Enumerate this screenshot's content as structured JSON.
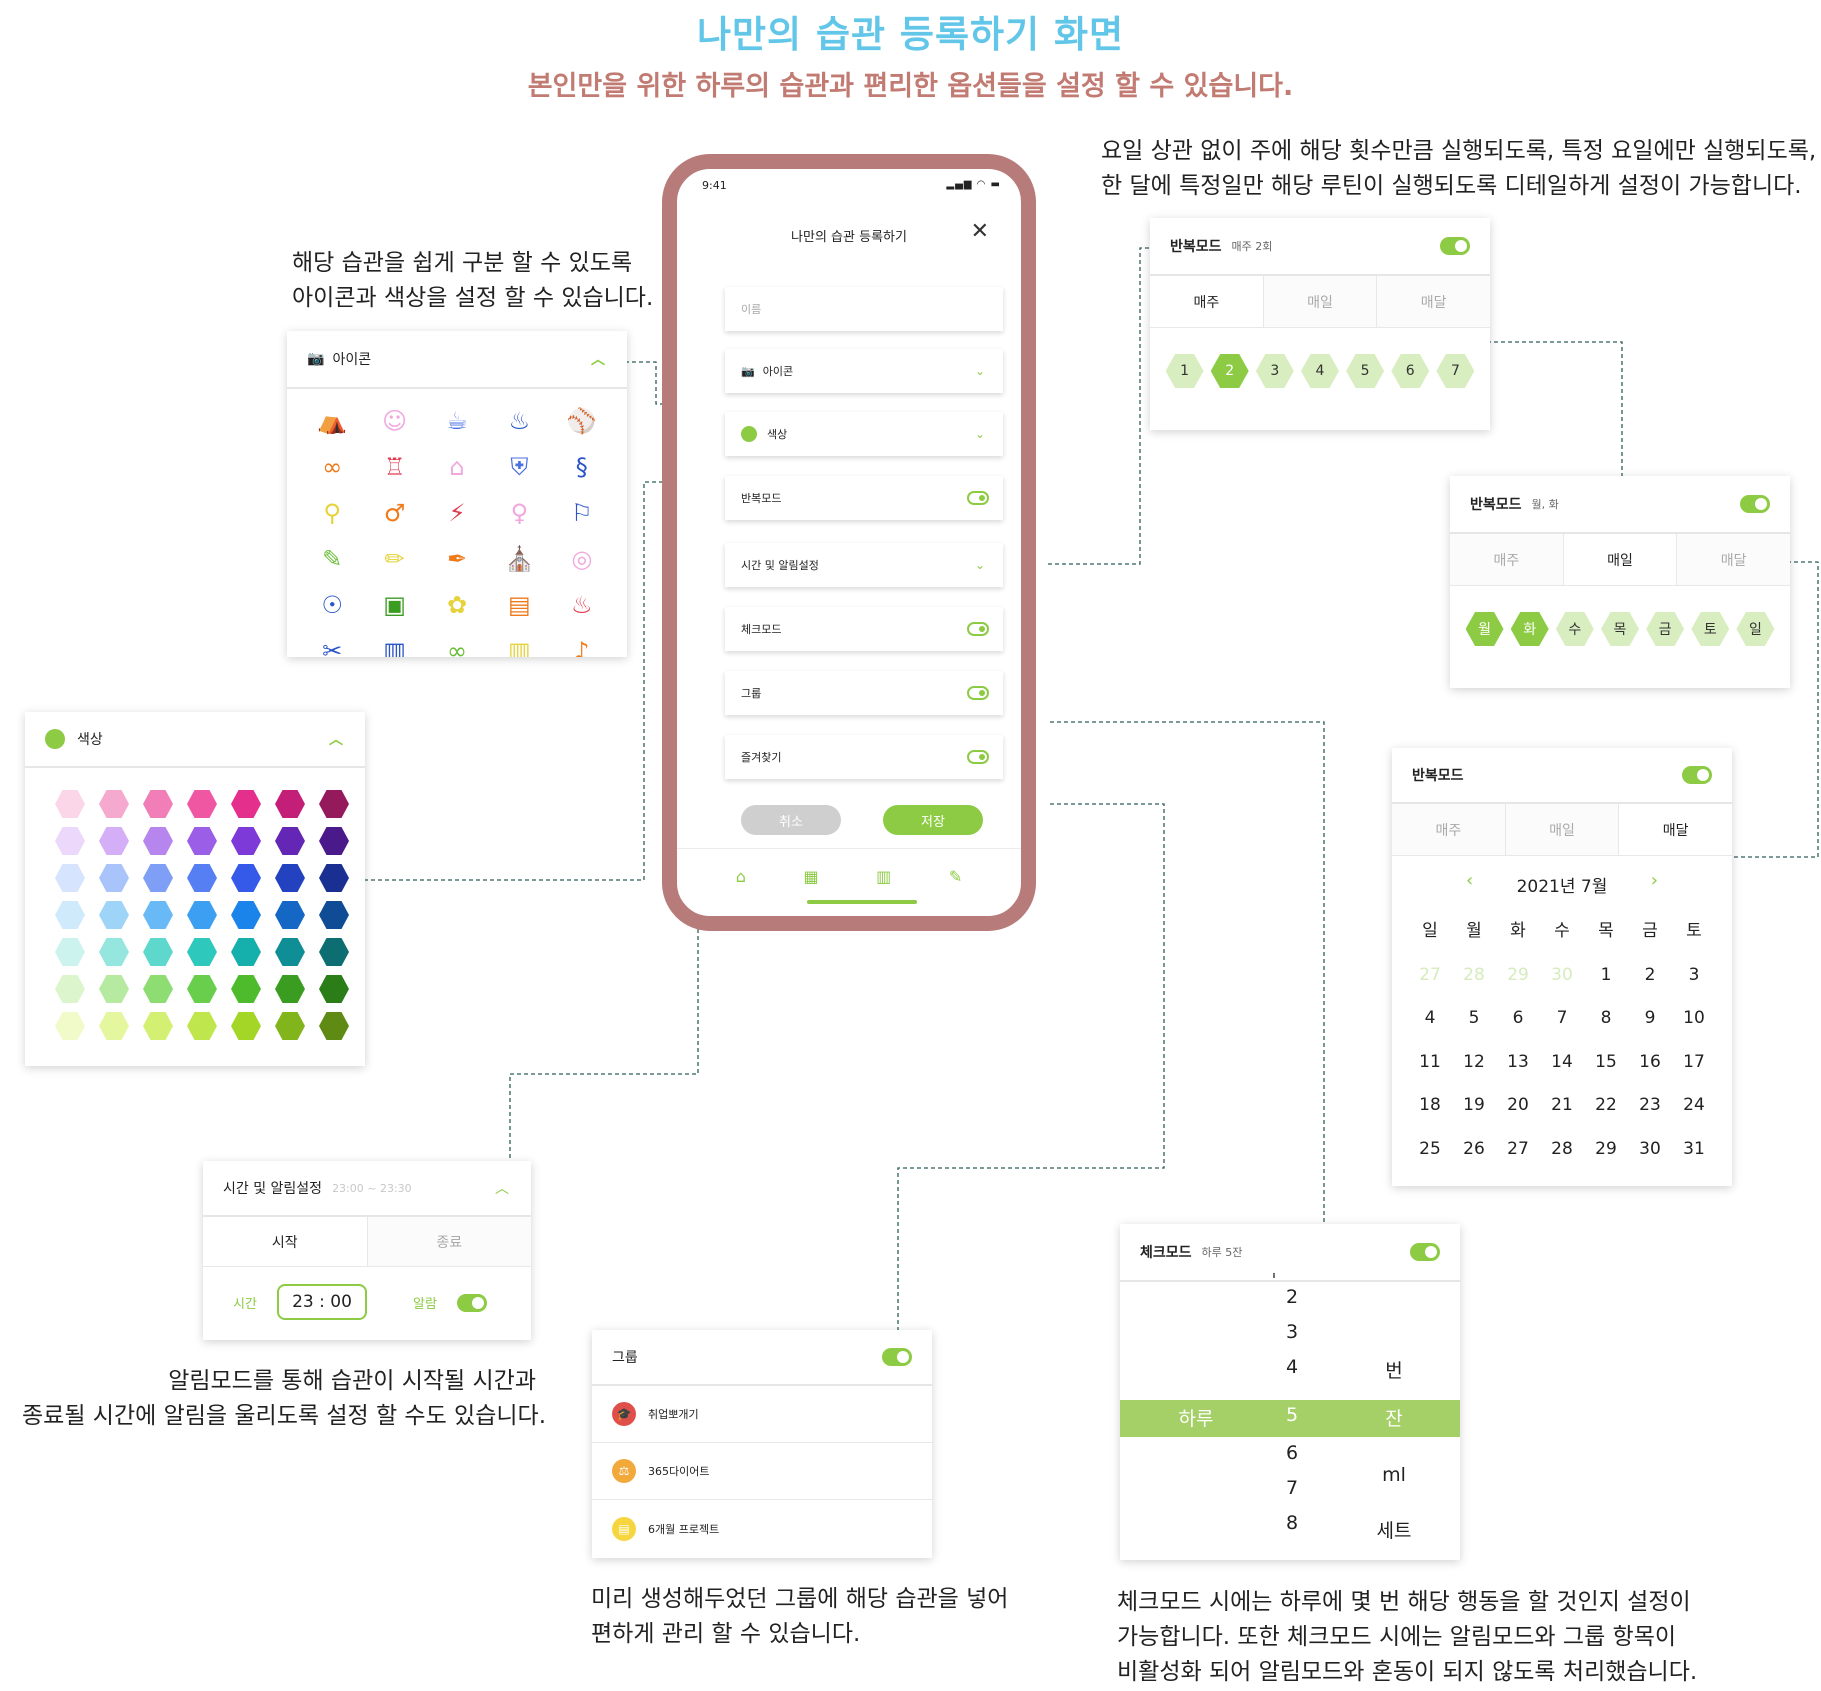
{
  "header": {
    "title": "나만의 습관 등록하기 화면",
    "subtitle": "본인만을 위한 하루의 습관과 편리한 옵션들을 설정 할 수 있습니다."
  },
  "descriptions": {
    "icon_color": [
      "해당 습관을 쉽게 구분 할 수 있도록",
      "아이콘과 색상을 설정 할 수 있습니다."
    ],
    "repeat": [
      "요일 상관 없이 주에 해당 횟수만큼 실행되도록, 특정 요일에만 실행되도록,",
      "한 달에 특정일만 해당 루틴이 실행되도록 디테일하게 설정이 가능합니다."
    ],
    "alarm": [
      "알림모드를 통해 습관이 시작될 시간과",
      "종료될 시간에 알림을 울리도록 설정 할 수도 있습니다."
    ],
    "group": [
      "미리 생성해두었던 그룹에 해당 습관을 넣어",
      "편하게 관리 할 수 있습니다."
    ],
    "check": [
      "체크모드 시에는 하루에 몇 번 해당 행동을 할 것인지 설정이",
      "가능합니다. 또한 체크모드 시에는 알림모드와 그룹 항목이",
      "비활성화 되어 알림모드와 혼동이 되지 않도록 처리했습니다."
    ]
  },
  "phone": {
    "time": "9:41",
    "title": "나만의 습관 등록하기",
    "name_placeholder": "이름",
    "rows": {
      "icon": "아이콘",
      "color": "색상",
      "repeat": "반복모드",
      "time_alarm": "시간 및 알림설정",
      "check": "체크모드",
      "group": "그룹",
      "favorite": "즐겨찾기"
    },
    "cancel": "취소",
    "save": "저장"
  },
  "icon_card": {
    "title": "아이콘"
  },
  "color_card": {
    "title": "색상",
    "rows": [
      [
        "#fbd6e8",
        "#f6a9cf",
        "#f27eb8",
        "#ef57a3",
        "#e52f8d",
        "#c41f78",
        "#951a5b"
      ],
      [
        "#ecd8fb",
        "#d4aef6",
        "#b785ee",
        "#9b5ee6",
        "#7e3ad8",
        "#6326b5",
        "#4a1a8a"
      ],
      [
        "#d6e4fd",
        "#a9c3fb",
        "#7f9ff7",
        "#577ff4",
        "#3559e8",
        "#2242c0",
        "#1a2f92"
      ],
      [
        "#cfeafb",
        "#9ed4f8",
        "#68b9f5",
        "#3d9ff2",
        "#1a84ea",
        "#1467c4",
        "#104c96"
      ],
      [
        "#cdf3ef",
        "#94e6de",
        "#5ed8cc",
        "#2ec8bc",
        "#15b0ab",
        "#0f8f95",
        "#0d6e72"
      ],
      [
        "#dcf5cc",
        "#b6eaa0",
        "#8edd73",
        "#69ce4c",
        "#4dbb2c",
        "#3a9c21",
        "#2b7d18"
      ],
      [
        "#f1fbc9",
        "#e4f79e",
        "#d3f072",
        "#bfe64c",
        "#a4d628",
        "#82b41c",
        "#5f8a14"
      ]
    ]
  },
  "repeat_weekly": {
    "title": "반복모드",
    "sub": "매주 2회",
    "tabs": [
      "매주",
      "매일",
      "매달"
    ],
    "items": [
      "1",
      "2",
      "3",
      "4",
      "5",
      "6",
      "7"
    ]
  },
  "repeat_daily": {
    "title": "반복모드",
    "sub": "월, 화",
    "tabs": [
      "매주",
      "매일",
      "매달"
    ],
    "items": [
      "월",
      "화",
      "수",
      "목",
      "금",
      "토",
      "일"
    ]
  },
  "repeat_monthly": {
    "title": "반복모드",
    "tabs": [
      "매주",
      "매일",
      "매달"
    ],
    "month": "2021년 7월",
    "weekdays": [
      "일",
      "월",
      "화",
      "수",
      "목",
      "금",
      "토"
    ],
    "days": [
      "27",
      "28",
      "29",
      "30",
      "1",
      "2",
      "3",
      "4",
      "5",
      "6",
      "7",
      "8",
      "9",
      "10",
      "11",
      "12",
      "13",
      "14",
      "15",
      "16",
      "17",
      "18",
      "19",
      "20",
      "21",
      "22",
      "23",
      "24",
      "25",
      "26",
      "27",
      "28",
      "29",
      "30",
      "31"
    ]
  },
  "time_card": {
    "title": "시간 및 알림설정",
    "sub": "23:00 ~ 23:30",
    "tabs": [
      "시작",
      "종료"
    ],
    "time_label": "시간",
    "time_value": "23 : 00",
    "alarm_label": "알람"
  },
  "group_card": {
    "title": "그룹",
    "items": [
      {
        "label": "취업뽀개기",
        "color": "#e0504b",
        "icon": "graduation-cap-icon"
      },
      {
        "label": "365다이어트",
        "color": "#f2a93b",
        "icon": "scale-icon"
      },
      {
        "label": "6개월 프로젝트",
        "color": "#f6d53e",
        "icon": "document-icon"
      }
    ]
  },
  "check_card": {
    "title": "체크모드",
    "sub": "하루 5잔",
    "left": "하루",
    "numbers": [
      "2",
      "3",
      "4",
      "5",
      "6",
      "7",
      "8"
    ],
    "units": [
      "번",
      "잔",
      "ml",
      "세트"
    ]
  }
}
